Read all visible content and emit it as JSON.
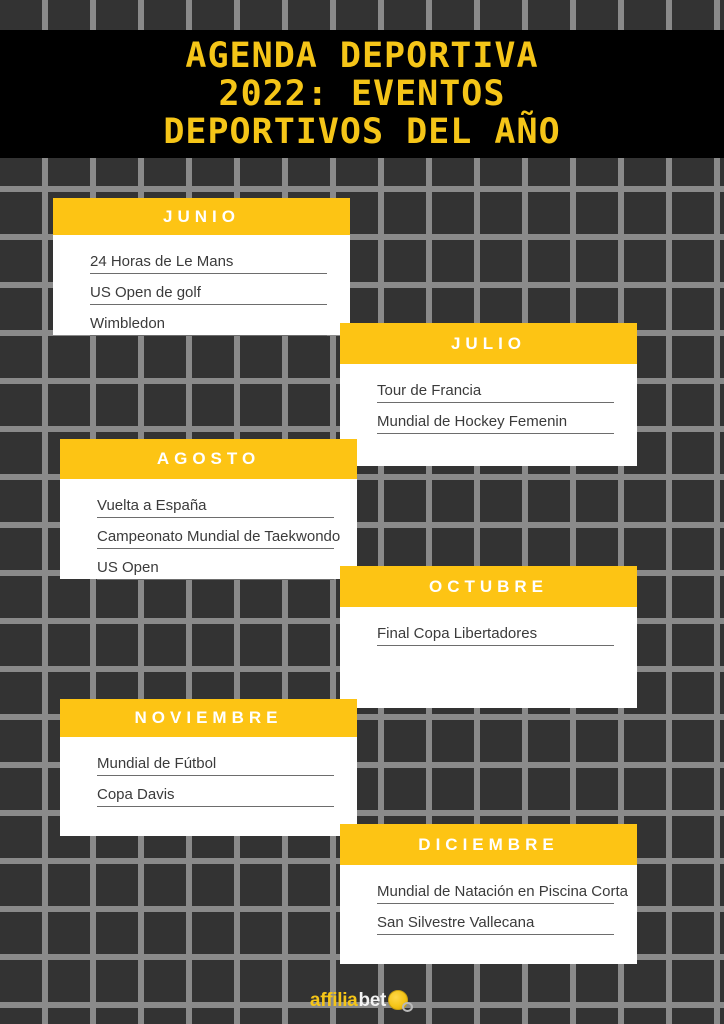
{
  "poster": {
    "title": "AGENDA DEPORTIVA\n2022: EVENTOS\nDEPORTIVOS DEL AÑO",
    "colors": {
      "accent_yellow": "#FDC414",
      "title_yellow": "#F5C518",
      "banner_black": "#000000",
      "grid_dark": "#333333",
      "grid_line": "#8a8a8a",
      "card_white": "#ffffff",
      "body_text": "#3b3b3b"
    }
  },
  "months": [
    {
      "name": "JUNIO",
      "events": [
        "24 Horas de Le Mans",
        "US Open de golf",
        "Wimbledon"
      ]
    },
    {
      "name": "JULIO",
      "events": [
        "Tour de Francia",
        "Mundial de Hockey Femenin"
      ]
    },
    {
      "name": "AGOSTO",
      "events": [
        "Vuelta a España",
        "Campeonato Mundial de Taekwondo",
        "US Open"
      ]
    },
    {
      "name": "OCTUBRE",
      "events": [
        "Final Copa Libertadores"
      ]
    },
    {
      "name": "NOVIEMBRE",
      "events": [
        "Mundial de Fútbol",
        "Copa Davis"
      ]
    },
    {
      "name": "DICIEMBRE",
      "events": [
        "Mundial de Natación en Piscina Corta",
        "San Silvestre Vallecana"
      ]
    }
  ],
  "footer": {
    "brand_part1": "affilia",
    "brand_part2": "bet",
    "mark": "whistle-icon"
  }
}
